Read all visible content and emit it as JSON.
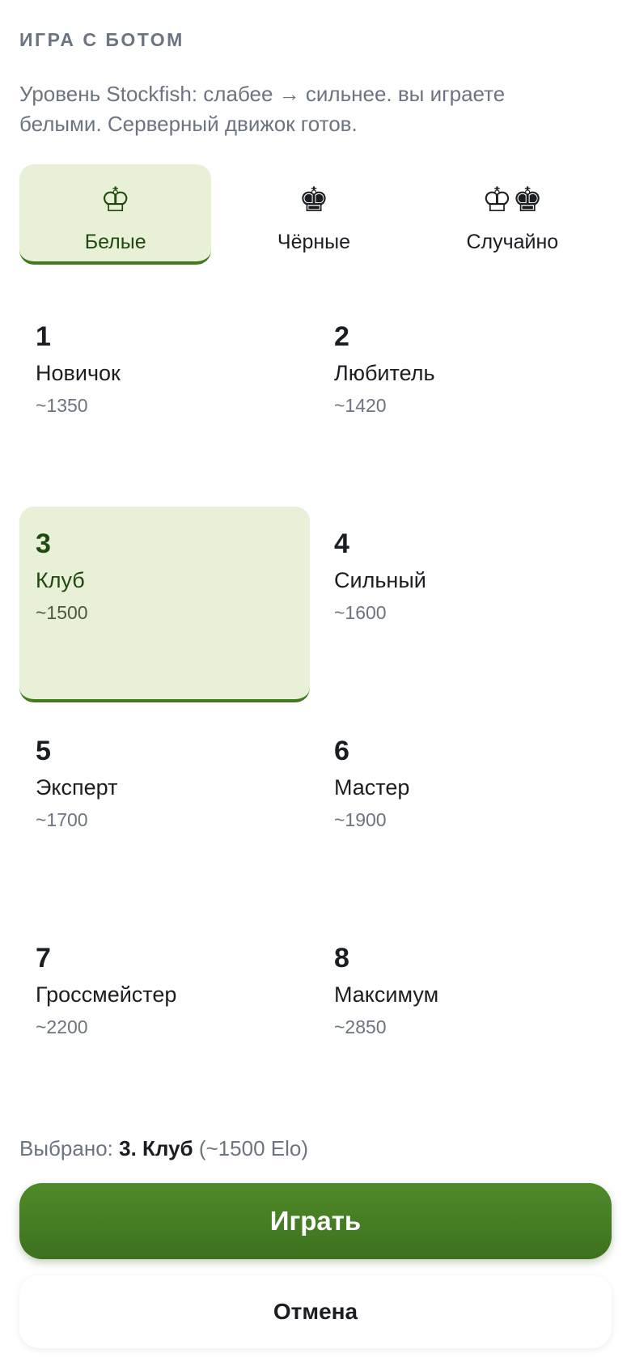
{
  "header": {
    "title": "ИГРА С БОТОМ"
  },
  "subtitle": "Уровень Stockfish: слабее → сильнее. вы играете белыми. Серверный движок готов.",
  "color_options": [
    {
      "label": "Белые",
      "glyph": "♔",
      "icon": "white-king-icon",
      "selected": true
    },
    {
      "label": "Чёрные",
      "glyph": "♚",
      "icon": "black-king-icon",
      "selected": false
    },
    {
      "label": "Случайно",
      "glyph": "♔♚",
      "icon": "random-kings-icon",
      "selected": false
    }
  ],
  "levels": [
    {
      "num": "1",
      "name": "Новичок",
      "elo": "~1350"
    },
    {
      "num": "2",
      "name": "Любитель",
      "elo": "~1420"
    },
    {
      "num": "3",
      "name": "Клуб",
      "elo": "~1500",
      "selected": true
    },
    {
      "num": "4",
      "name": "Сильный",
      "elo": "~1600"
    },
    {
      "num": "5",
      "name": "Эксперт",
      "elo": "~1700"
    },
    {
      "num": "6",
      "name": "Мастер",
      "elo": "~1900"
    },
    {
      "num": "7",
      "name": "Гроссмейстер",
      "elo": "~2200"
    },
    {
      "num": "8",
      "name": "Максимум",
      "elo": "~2850"
    }
  ],
  "summary": {
    "prefix": "Выбрано:",
    "value": "3. Клуб",
    "suffix": "(~1500 Elo)"
  },
  "buttons": {
    "play": "Играть",
    "cancel": "Отмена"
  },
  "colors": {
    "accent": "#3f7a1d",
    "selected_bg": "#e8f0d8",
    "muted_text": "#6b7480"
  }
}
